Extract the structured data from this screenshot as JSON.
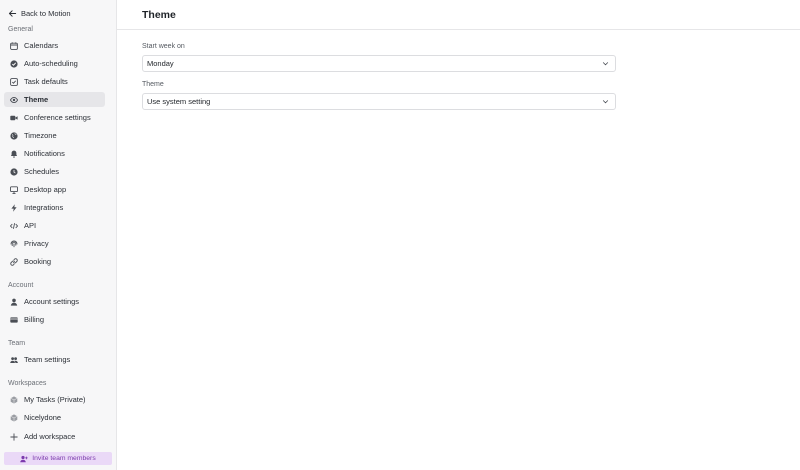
{
  "sidebar": {
    "back_label": "Back to Motion",
    "sections": {
      "general": "General",
      "account": "Account",
      "team": "Team",
      "workspaces": "Workspaces"
    },
    "general_items": [
      {
        "label": "Calendars",
        "icon": "calendar-icon"
      },
      {
        "label": "Auto-scheduling",
        "icon": "check-circle-icon"
      },
      {
        "label": "Task defaults",
        "icon": "task-check-icon"
      },
      {
        "label": "Theme",
        "icon": "eye-icon",
        "active": true
      },
      {
        "label": "Conference settings",
        "icon": "video-icon"
      },
      {
        "label": "Timezone",
        "icon": "globe-icon"
      },
      {
        "label": "Notifications",
        "icon": "bell-icon"
      },
      {
        "label": "Schedules",
        "icon": "clock-icon"
      },
      {
        "label": "Desktop app",
        "icon": "monitor-icon"
      },
      {
        "label": "Integrations",
        "icon": "bolt-icon"
      },
      {
        "label": "API",
        "icon": "code-icon"
      },
      {
        "label": "Privacy",
        "icon": "fingerprint-icon"
      },
      {
        "label": "Booking",
        "icon": "link-icon"
      }
    ],
    "account_items": [
      {
        "label": "Account settings",
        "icon": "user-icon"
      },
      {
        "label": "Billing",
        "icon": "credit-card-icon"
      }
    ],
    "team_items": [
      {
        "label": "Team settings",
        "icon": "users-icon"
      }
    ],
    "workspace_items": [
      {
        "label": "My Tasks (Private)",
        "icon": "cube-icon"
      },
      {
        "label": "Nicelydone",
        "icon": "cube-icon"
      },
      {
        "label": "Add workspace",
        "icon": "plus-icon"
      }
    ],
    "invite_label": "Invite team members"
  },
  "main": {
    "title": "Theme",
    "start_week": {
      "label": "Start week on",
      "value": "Monday"
    },
    "theme": {
      "label": "Theme",
      "value": "Use system setting"
    }
  },
  "colors": {
    "sidebar_bg": "#f7f7f8",
    "active_bg": "#e6e6e9",
    "invite_bg": "#ead9f7",
    "invite_text": "#7c3aad"
  }
}
